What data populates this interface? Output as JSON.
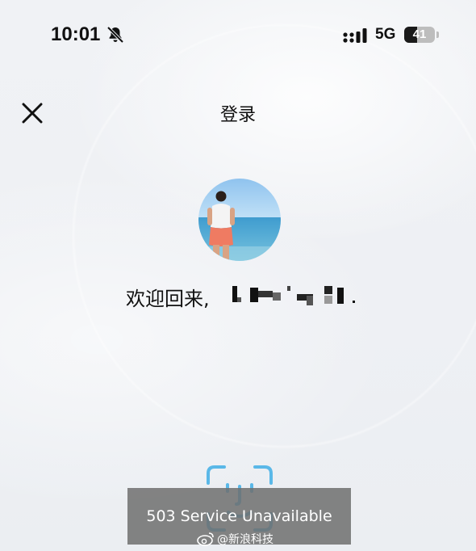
{
  "status_bar": {
    "time": "10:01",
    "network": "5G",
    "battery_level": "41",
    "battery_fraction": 0.41,
    "silent_icon": "bell-slash-icon",
    "signal_icon": "cellular-signal-icon"
  },
  "header": {
    "close_icon": "close-icon",
    "title": "登录"
  },
  "profile": {
    "avatar": "user-avatar-photo",
    "welcome_text": "欢迎回来,"
  },
  "login": {
    "face_id_icon": "face-id-icon"
  },
  "toast": {
    "message": "503 Service Unavailable"
  },
  "watermark": {
    "text": "@新浪科技",
    "logo": "weibo-logo"
  },
  "colors": {
    "background": "#eef0f3",
    "face_id": "#5ab8e8",
    "toast": "#6e6e6e"
  }
}
